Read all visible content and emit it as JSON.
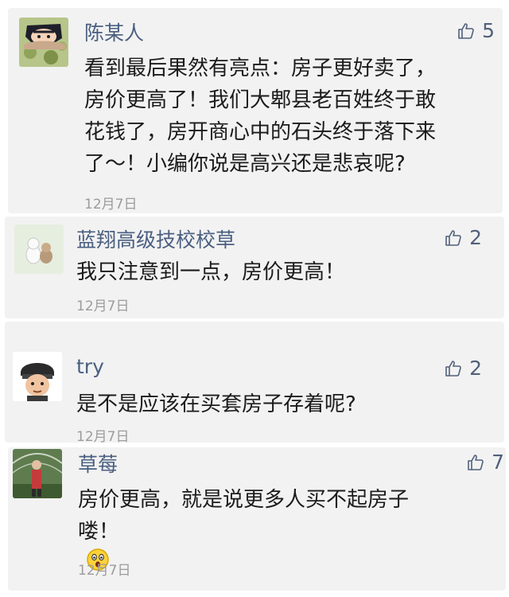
{
  "comments": [
    {
      "name": "陈某人",
      "likes": "5",
      "lines": [
        "看到最后果然有亮点：房子更好卖了，",
        "房价更高了！我们大郫县老百姓终于敢",
        "花钱了，房开商心中的石头终于落下来",
        "了～！小编你说是高兴还是悲哀呢?"
      ],
      "date": "12月7日",
      "avatar_icon": "cartoon-character-avatar"
    },
    {
      "name": "蓝翔高级技校校草",
      "likes": "2",
      "lines": [
        "我只注意到一点，房价更高！"
      ],
      "date": "12月7日",
      "avatar_icon": "toy-figure-avatar"
    },
    {
      "name": "try",
      "likes": "2",
      "lines": [
        "是不是应该在买套房子存着呢?"
      ],
      "date": "12月7日",
      "avatar_icon": "soldier-cartoon-avatar"
    },
    {
      "name": "草莓",
      "likes": "7",
      "lines": [
        "房价更高，就是说更多人买不起房子",
        "喽！"
      ],
      "date": "12月7日",
      "avatar_icon": "greenhouse-photo-avatar",
      "emoji_icon": "surprised-face-emoji"
    }
  ],
  "colors": {
    "name": "#4a5f80",
    "like": "#51607a",
    "date": "#9c9c9c",
    "card": "#f2f2f2"
  }
}
